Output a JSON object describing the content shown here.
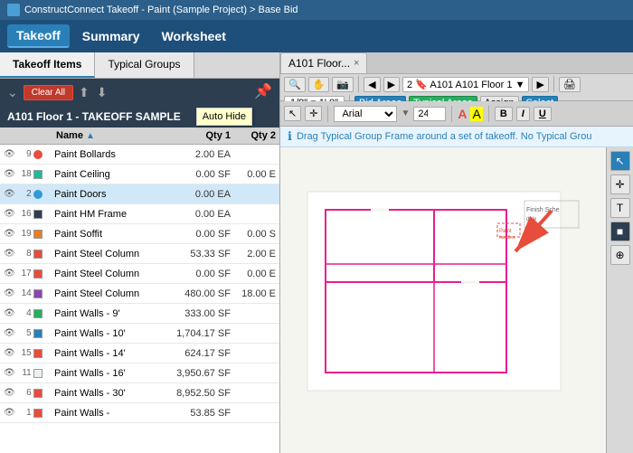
{
  "titleBar": {
    "text": "ConstructConnect Takeoff - Paint (Sample Project) > Base Bid"
  },
  "menuBar": {
    "items": [
      {
        "label": "Takeoff",
        "active": true
      },
      {
        "label": "Summary",
        "active": false
      },
      {
        "label": "Worksheet",
        "active": false
      }
    ]
  },
  "leftPanel": {
    "tabs": [
      {
        "label": "Takeoff Items",
        "active": true
      },
      {
        "label": "Typical Groups",
        "active": false
      }
    ],
    "toolbar": {
      "clearAll": "Clear All",
      "autoHideTooltip": "Auto Hide"
    },
    "sectionHeader": "A101 Floor 1 - TAKEOFF SAMPLE",
    "columns": {
      "name": "Name",
      "qty1": "Qty 1",
      "qty2": "Qty 2"
    },
    "rows": [
      {
        "num": "9",
        "color": "#e74c3c",
        "shape": "circle",
        "name": "Paint Bollards",
        "qty1": "2.00 EA",
        "qty2": ""
      },
      {
        "num": "18",
        "color": "#1abc9c",
        "shape": "square",
        "name": "Paint Ceiling",
        "qty1": "0.00 SF",
        "qty2": "0.00 E"
      },
      {
        "num": "2",
        "color": "#3498db",
        "shape": "circle",
        "name": "Paint Doors",
        "qty1": "0.00 EA",
        "qty2": "",
        "selected": true
      },
      {
        "num": "16",
        "color": "#2c3e50",
        "shape": "square",
        "name": "Paint HM Frame",
        "qty1": "0.00 EA",
        "qty2": ""
      },
      {
        "num": "19",
        "color": "#e67e22",
        "shape": "square",
        "name": "Paint Soffit",
        "qty1": "0.00 SF",
        "qty2": "0.00 S"
      },
      {
        "num": "8",
        "color": "#e74c3c",
        "shape": "square",
        "name": "Paint Steel Column",
        "qty1": "53.33 SF",
        "qty2": "2.00 E"
      },
      {
        "num": "17",
        "color": "#e74c3c",
        "shape": "square",
        "name": "Paint Steel Column",
        "qty1": "0.00 SF",
        "qty2": "0.00 E"
      },
      {
        "num": "14",
        "color": "#8e44ad",
        "shape": "square",
        "name": "Paint Steel Column",
        "qty1": "480.00 SF",
        "qty2": "18.00 E"
      },
      {
        "num": "4",
        "color": "#27ae60",
        "shape": "square",
        "name": "Paint Walls - 9'",
        "qty1": "333.00 SF",
        "qty2": ""
      },
      {
        "num": "5",
        "color": "#2980b9",
        "shape": "square",
        "name": "Paint Walls - 10'",
        "qty1": "1,704.17 SF",
        "qty2": ""
      },
      {
        "num": "15",
        "color": "#e74c3c",
        "shape": "square",
        "name": "Paint Walls - 14'",
        "qty1": "624.17 SF",
        "qty2": ""
      },
      {
        "num": "11",
        "color": "#ecf0f1",
        "shape": "square",
        "name": "Paint Walls - 16'",
        "qty1": "3,950.67 SF",
        "qty2": ""
      },
      {
        "num": "6",
        "color": "#e74c3c",
        "shape": "square",
        "name": "Paint Walls - 30'",
        "qty1": "8,952.50 SF",
        "qty2": ""
      },
      {
        "num": "1",
        "color": "#e74c3c",
        "shape": "square",
        "name": "Paint Walls -",
        "qty1": "53.85 SF",
        "qty2": ""
      }
    ]
  },
  "rightPanel": {
    "tab": {
      "label": "A101 Floor...",
      "closeBtn": "×"
    },
    "viewerToolbar": {
      "searchIcon": "🔍",
      "handIcon": "✋",
      "cameraIcon": "📷",
      "prevBtn": "◀",
      "nextBtn": "▶",
      "pageDisplay": "2  🔖 A101 A101 Floor 1",
      "forwardBtn": "▶",
      "scaleLabel": "1/8\" = 1' 0\"",
      "bidAreasBtn": "Bid Areas",
      "typicalAreasBtn": "Typical Areas",
      "assignBtn": "Assign",
      "selectBtn": "Select",
      "floorLabel": "A101 Floor 1 - TAKEO"
    },
    "annotationBar": {
      "fontName": "Arial",
      "fontSize": "24",
      "boldBtn": "B",
      "italicBtn": "I",
      "underlineBtn": "U"
    },
    "infoBar": {
      "message": "Drag Typical Group Frame around a set of takeoff. No Typical Grou"
    }
  }
}
